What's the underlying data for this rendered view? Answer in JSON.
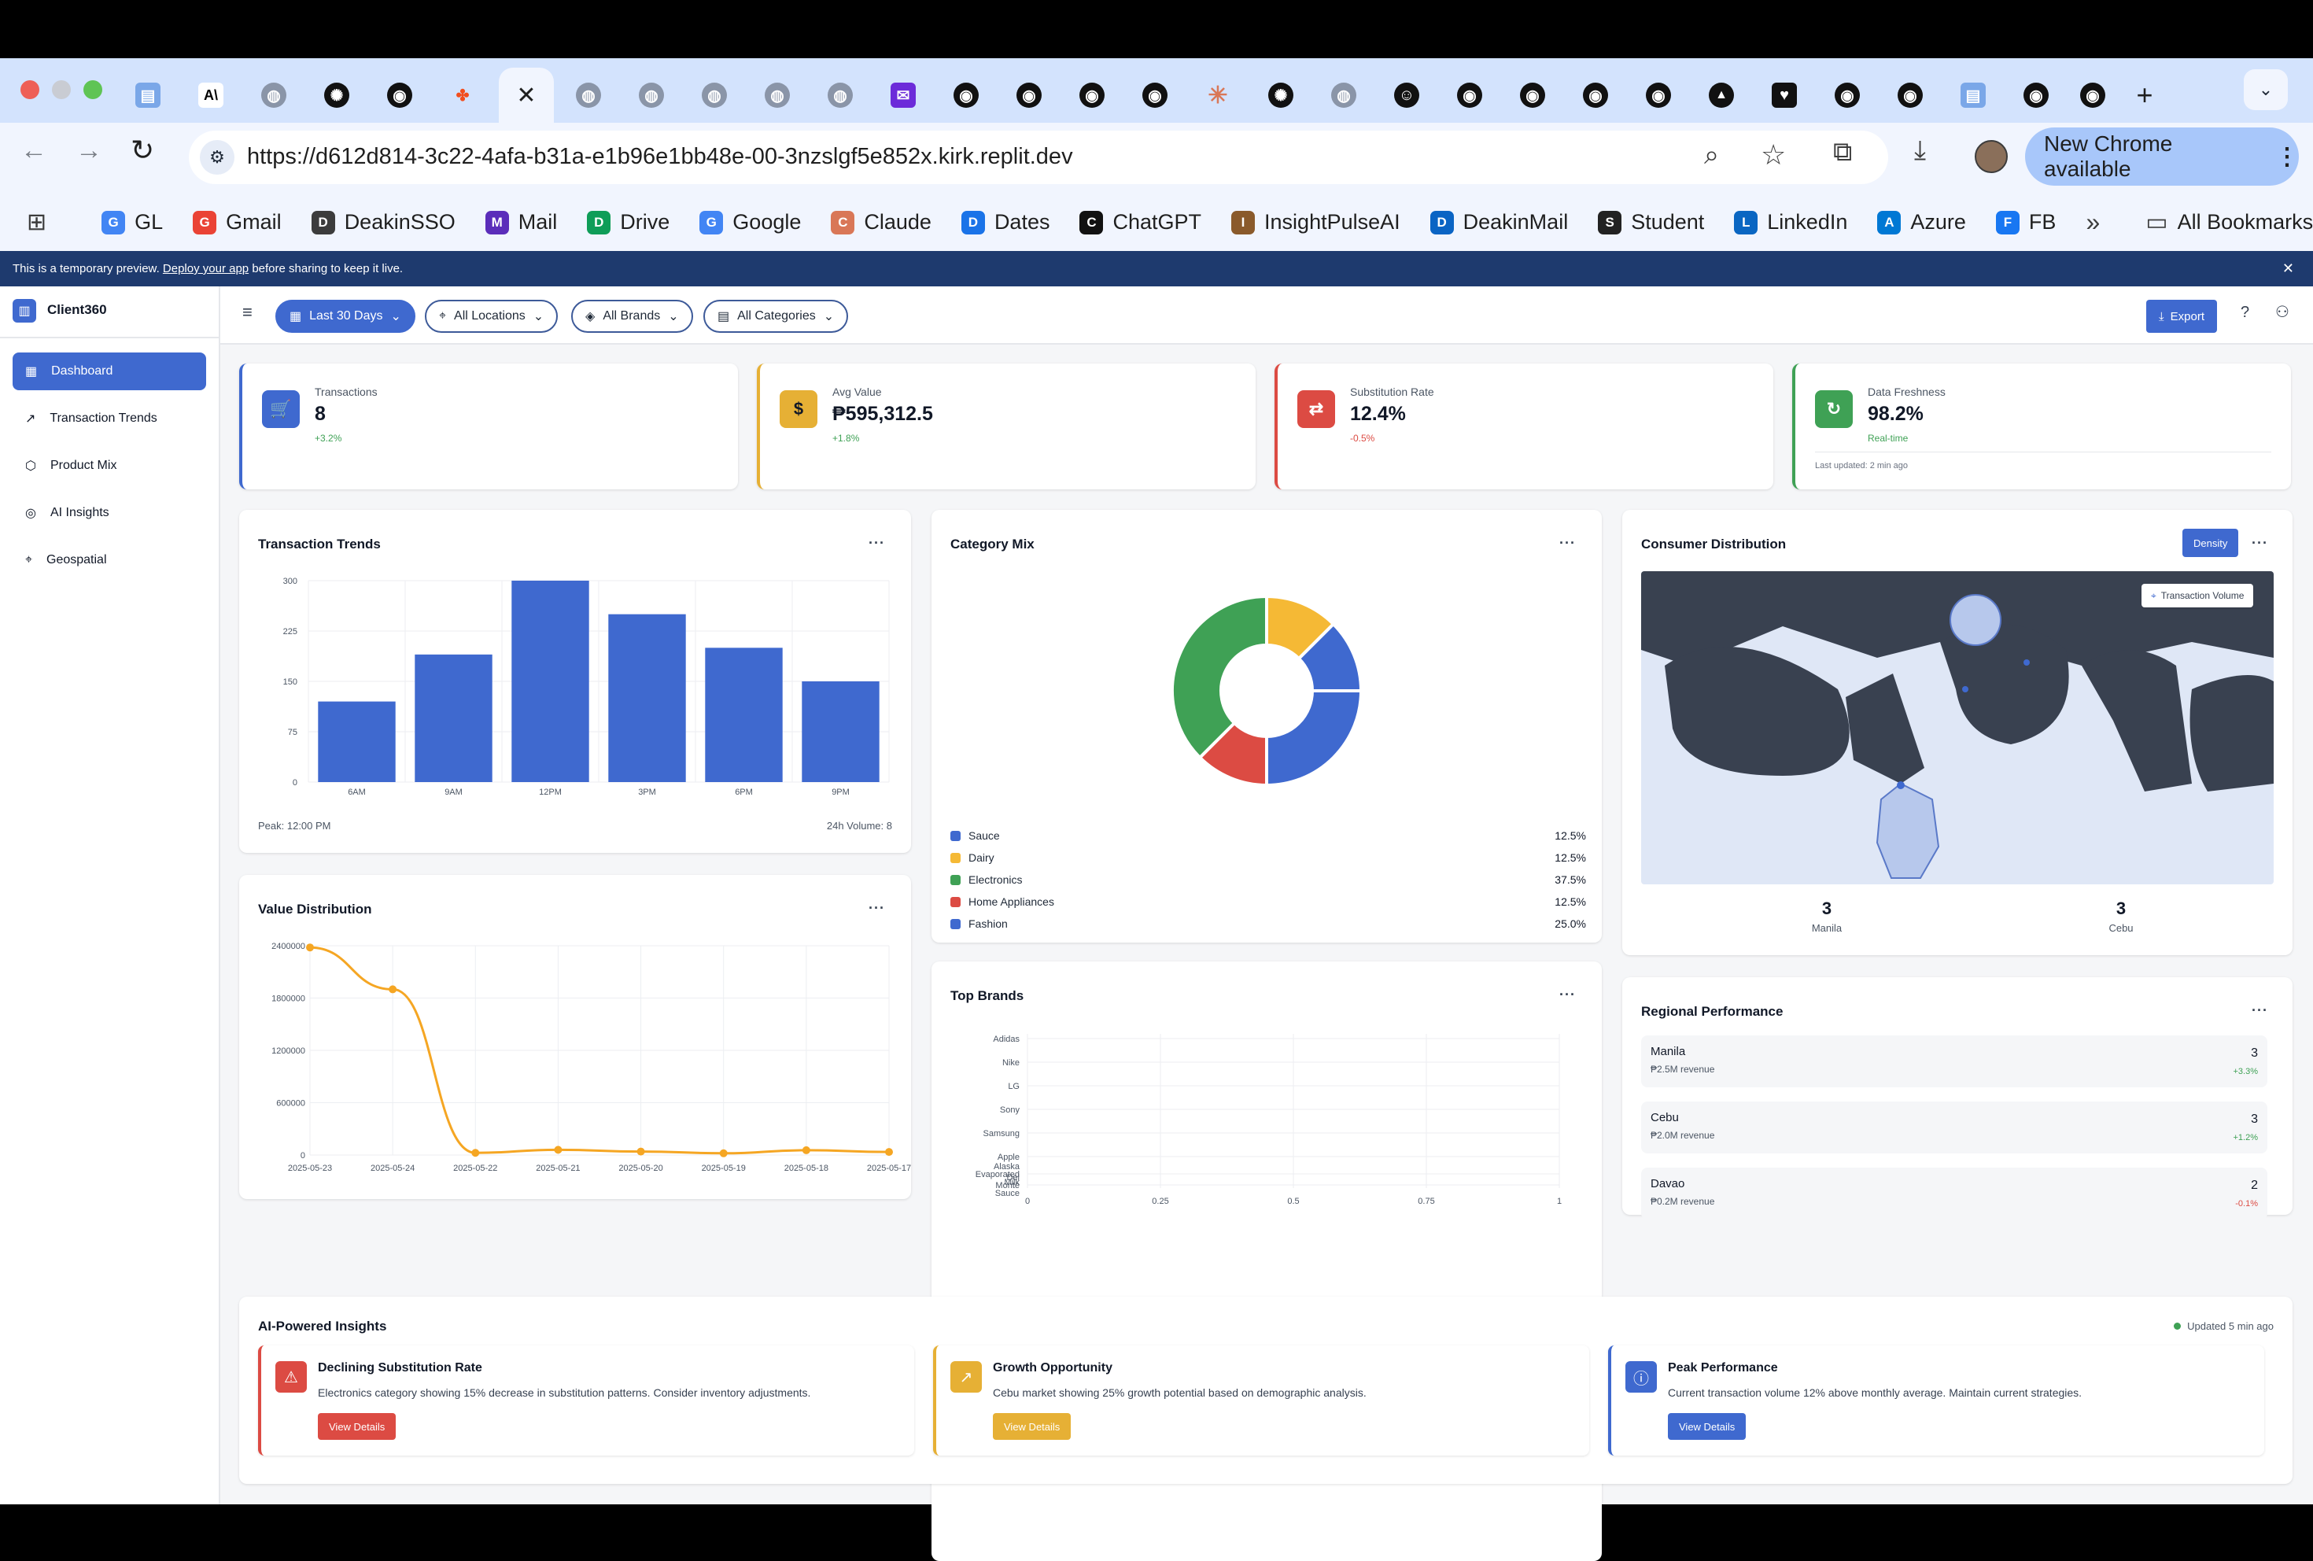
{
  "browser": {
    "url": "https://d612d814-3c22-4afa-b31a-e1b96e1bb48e-00-3nzslgf5e852x.kirk.replit.dev",
    "update_label": "New Chrome available",
    "bookmarks": [
      {
        "label": "GL",
        "icon": "google-g-icon",
        "color": "#4285f4"
      },
      {
        "label": "Gmail",
        "icon": "gmail-icon",
        "color": "#ea4335"
      },
      {
        "label": "DeakinSSO",
        "icon": "deakin-icon",
        "color": "#3c3c3c"
      },
      {
        "label": "Mail",
        "icon": "mail-icon",
        "color": "#5b2dba"
      },
      {
        "label": "Drive",
        "icon": "drive-icon",
        "color": "#0f9d58"
      },
      {
        "label": "Google",
        "icon": "google-g-icon",
        "color": "#4285f4"
      },
      {
        "label": "Claude",
        "icon": "claude-icon",
        "color": "#d97757"
      },
      {
        "label": "Dates",
        "icon": "calendar-icon",
        "color": "#1a73e8"
      },
      {
        "label": "ChatGPT",
        "icon": "chatgpt-icon",
        "color": "#111111"
      },
      {
        "label": "InsightPulseAI",
        "icon": "insightpulse-icon",
        "color": "#8a5a2b"
      },
      {
        "label": "DeakinMail",
        "icon": "outlook-icon",
        "color": "#0a64c4"
      },
      {
        "label": "Student",
        "icon": "globe-icon",
        "color": "#222222"
      },
      {
        "label": "LinkedIn",
        "icon": "linkedin-icon",
        "color": "#0a66c2"
      },
      {
        "label": "Azure",
        "icon": "azure-icon",
        "color": "#0078d4"
      },
      {
        "label": "FB",
        "icon": "facebook-icon",
        "color": "#1877f2"
      }
    ],
    "all_bookmarks": "All Bookmarks"
  },
  "banner": {
    "prefix": "This is a temporary preview.",
    "link": "Deploy your app",
    "suffix": "before sharing to keep it live."
  },
  "app": {
    "name": "Client360",
    "nav": [
      {
        "label": "Dashboard",
        "icon": "dashboard-icon"
      },
      {
        "label": "Transaction Trends",
        "icon": "trending-up-icon"
      },
      {
        "label": "Product Mix",
        "icon": "box-icon"
      },
      {
        "label": "AI Insights",
        "icon": "brain-icon"
      },
      {
        "label": "Geospatial",
        "icon": "map-pin-icon"
      }
    ],
    "filters": {
      "date": "Last 30 Days",
      "locations": "All Locations",
      "brands": "All Brands",
      "categories": "All Categories"
    },
    "export_label": "Export"
  },
  "kpis": [
    {
      "label": "Transactions",
      "value": "8",
      "delta": "+3.2%",
      "accent": "#3f69cf"
    },
    {
      "label": "Avg Value",
      "value": "₱595,312.5",
      "delta": "+1.8%",
      "accent": "#e6b035"
    },
    {
      "label": "Substitution Rate",
      "value": "12.4%",
      "delta": "-0.5%",
      "accent": "#dc4b43"
    },
    {
      "label": "Data Freshness",
      "value": "98.2%",
      "delta": "Real-time",
      "note": "Last updated: 2 min ago",
      "accent": "#3fa155"
    }
  ],
  "panels": {
    "trends_title": "Transaction Trends",
    "trends_peak": "Peak: 12:00 PM",
    "trends_volume": "24h Volume: 8",
    "value_title": "Value Distribution",
    "category_title": "Category Mix",
    "brands_title": "Top Brands",
    "consumer_title": "Consumer Distribution",
    "consumer_mode": "Density",
    "consumer_legend": "Transaction Volume",
    "consumer_stats": [
      {
        "value": "3",
        "label": "Manila"
      },
      {
        "value": "3",
        "label": "Cebu"
      }
    ],
    "regional_title": "Regional Performance",
    "regions": [
      {
        "name": "Manila",
        "revenue": "₱2.5M revenue",
        "count": "3",
        "delta": "+3.3%",
        "trend": "up"
      },
      {
        "name": "Cebu",
        "revenue": "₱2.0M revenue",
        "count": "3",
        "delta": "+1.2%",
        "trend": "up"
      },
      {
        "name": "Davao",
        "revenue": "₱0.2M revenue",
        "count": "2",
        "delta": "-0.1%",
        "trend": "down"
      }
    ]
  },
  "insights": {
    "title": "AI-Powered Insights",
    "updated": "Updated 5 min ago",
    "cards": [
      {
        "title": "Declining Substitution Rate",
        "text": "Electronics category showing 15% decrease in substitution patterns. Consider inventory adjustments.",
        "button": "View Details",
        "color": "#dc4b43"
      },
      {
        "title": "Growth Opportunity",
        "text": "Cebu market showing 25% growth potential based on demographic analysis.",
        "button": "View Details",
        "color": "#e6b035"
      },
      {
        "title": "Peak Performance",
        "text": "Current transaction volume 12% above monthly average. Maintain current strategies.",
        "button": "View Details",
        "color": "#3f69cf"
      }
    ]
  },
  "chart_data": [
    {
      "id": "trends",
      "type": "bar",
      "title": "Transaction Trends",
      "categories": [
        "6AM",
        "9AM",
        "12PM",
        "3PM",
        "6PM",
        "9PM"
      ],
      "values": [
        120,
        190,
        300,
        250,
        200,
        150
      ],
      "yticks": [
        0,
        75,
        150,
        225,
        300
      ],
      "ylim": [
        0,
        300
      ],
      "color": "#3f69cf",
      "grid": true
    },
    {
      "id": "value",
      "type": "line",
      "title": "Value Distribution",
      "x": [
        "2025-05-23",
        "2025-05-24",
        "2025-05-22",
        "2025-05-21",
        "2025-05-20",
        "2025-05-19",
        "2025-05-18",
        "2025-05-17"
      ],
      "values": [
        2380000,
        1900000,
        25000,
        60000,
        40000,
        20000,
        55000,
        35000
      ],
      "yticks": [
        0,
        600000,
        1200000,
        1800000,
        2400000
      ],
      "ylim": [
        0,
        2400000
      ],
      "color": "#f5a623",
      "grid": true
    },
    {
      "id": "category",
      "type": "pie",
      "title": "Category Mix",
      "labels": [
        "Sauce",
        "Dairy",
        "Electronics",
        "Home Appliances",
        "Fashion"
      ],
      "percent_labels": [
        "12.5%",
        "12.5%",
        "37.5%",
        "12.5%",
        "25.0%"
      ],
      "values": [
        12.5,
        12.5,
        37.5,
        12.5,
        25.0
      ],
      "colors": [
        "#3f69cf",
        "#f5b935",
        "#3fa155",
        "#dc4b43",
        "#3f69cf"
      ],
      "ring_order": [
        "Dairy",
        "Sauce",
        "Fashion",
        "Home Appliances",
        "Electronics"
      ],
      "ring_colors": [
        "#f5b935",
        "#3f69cf",
        "#3f69cf",
        "#dc4b43",
        "#3fa155"
      ],
      "ring_values": [
        12.5,
        12.5,
        25.0,
        12.5,
        37.5
      ]
    },
    {
      "id": "brands",
      "type": "bar",
      "orientation": "horizontal",
      "title": "Top Brands",
      "categories": [
        "Adidas",
        "Nike",
        "LG",
        "Sony",
        "Samsung",
        "Apple",
        "Alaska Evaporated Milk",
        "Del Monte Sauce"
      ],
      "values": [
        0,
        0,
        0,
        0,
        0,
        0,
        0,
        0
      ],
      "xticks": [
        "0",
        "0.25",
        "0.5",
        "0.75",
        "1"
      ],
      "xlim": [
        0,
        1
      ],
      "grid": true
    }
  ]
}
